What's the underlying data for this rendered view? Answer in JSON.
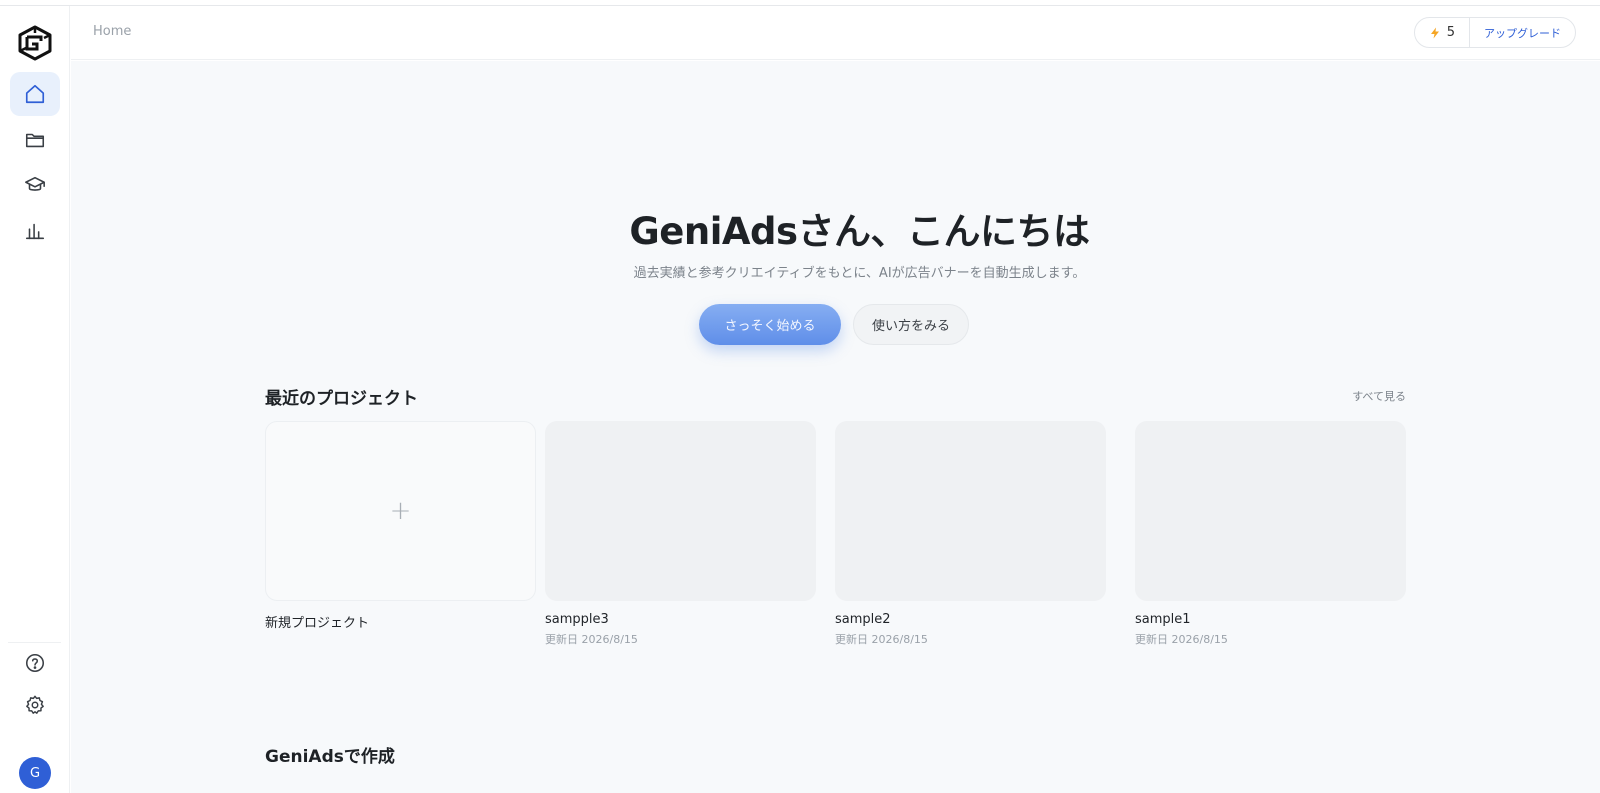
{
  "header": {
    "breadcrumb": "Home",
    "credits": "5",
    "upgrade_label": "アップグレード"
  },
  "sidebar": {
    "items": [
      {
        "name": "home",
        "icon": "home-icon",
        "active": true
      },
      {
        "name": "projects",
        "icon": "folder-icon",
        "active": false
      },
      {
        "name": "learn",
        "icon": "graduation-cap-icon",
        "active": false
      },
      {
        "name": "analytics",
        "icon": "bar-chart-icon",
        "active": false
      }
    ],
    "bottom": [
      {
        "name": "help",
        "icon": "help-circle-icon"
      },
      {
        "name": "settings",
        "icon": "gear-icon"
      }
    ],
    "avatar_initial": "G"
  },
  "hero": {
    "title": "GeniAdsさん、こんにちは",
    "subtitle": "過去実績と参考クリエイティブをもとに、AIが広告バナーを自動生成します。",
    "primary_button": "さっそく始める",
    "secondary_button": "使い方をみる"
  },
  "recent": {
    "title": "最近のプロジェクト",
    "see_all": "すべて見る",
    "new_project_label": "新規プロジェクト",
    "projects": [
      {
        "name": "sampple3",
        "updated": "更新日 2026/8/15"
      },
      {
        "name": "sample2",
        "updated": "更新日 2026/8/15"
      },
      {
        "name": "sample1",
        "updated": "更新日 2026/8/15"
      }
    ]
  },
  "create_section": {
    "title": "GeniAdsで作成"
  },
  "colors": {
    "accent": "#2f5fd6",
    "primary_button": "#5f8ee9",
    "background": "#f7f9fb"
  }
}
